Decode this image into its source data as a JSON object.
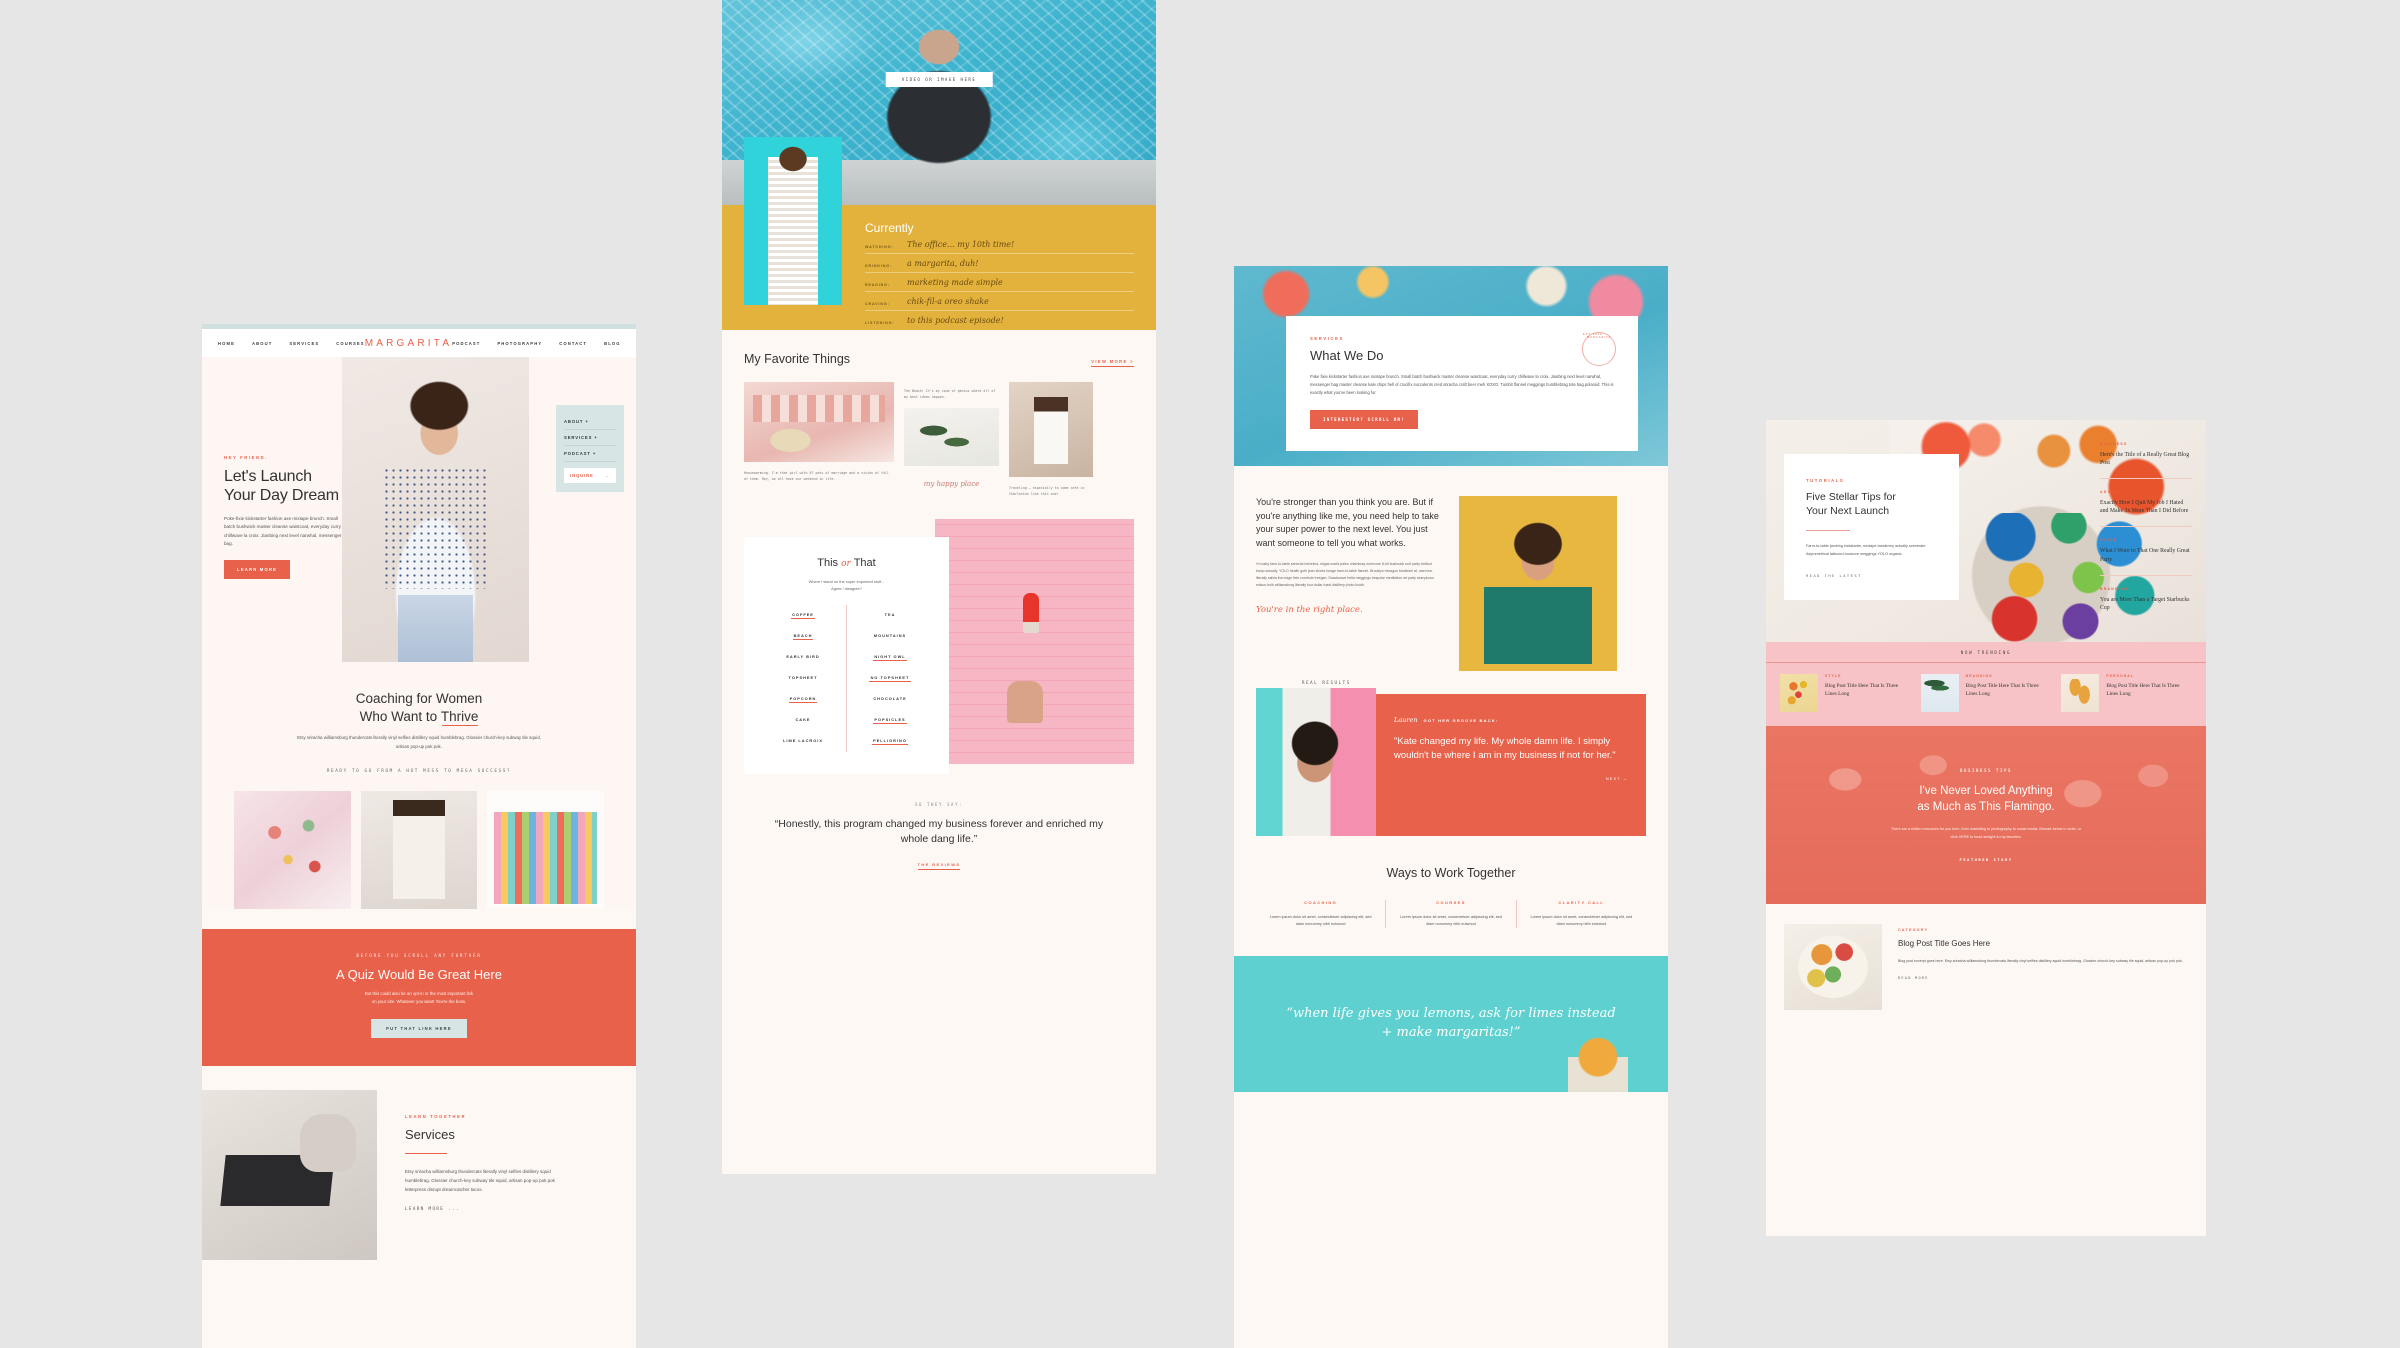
{
  "mockup1": {
    "nav": {
      "left": [
        "HOME",
        "ABOUT",
        "SERVICES",
        "COURSES"
      ],
      "brand": "MARGARITA",
      "right": [
        "PODCAST",
        "PHOTOGRAPHY",
        "CONTACT",
        "BLOG"
      ]
    },
    "sidecard": {
      "items": [
        "ABOUT +",
        "SERVICES +",
        "PODCAST +"
      ],
      "inquire_label": "INQUIRE",
      "inquire_arrow": "→"
    },
    "hero": {
      "eyebrow": "HEY FRIEND.",
      "title_line1": "Let's Launch",
      "title_line2": "Your Day Dream",
      "body": "Poke-fixie kickstarter fashion axe mixtape brunch. Small batch bushwick master cleanse waistcoat, everyday curry chillwave la croix. Jianbing next level narwhal, messenger bag.",
      "cta": "LEARN MORE"
    },
    "coaching": {
      "title_line1": "Coaching for Women",
      "title_line2_pre": "Who Want to ",
      "title_line2_accent": "Thrive",
      "body": "Etsy sriracha williamsburg thundercats literally vinyl selfies distillery squid humblebrag. Glossier church-key subway tile squid, artisan pop-up pok pok.",
      "ready": "READY TO GO FROM A HOT MESS TO MEGA SUCCESS?"
    },
    "quiz": {
      "eyebrow": "BEFORE YOU SCROLL ANY FURTHER",
      "title": "A Quiz Would Be Great Here",
      "body_line1": "But this could also be an opt-in or the most important link",
      "body_line2": "on your site. Whatever you want! You're the boss.",
      "cta": "PUT THAT LINK HERE"
    },
    "services": {
      "eyebrow": "LEARN TOGETHER",
      "title": "Services",
      "body": "Etsy sriracha williamsburg thundercats literally vinyl selfies distillery squid humblebrag. Glossier church-key subway tile squid, artisan pop-up pok pok letterpress disrupt dreamcatcher tacos.",
      "more": "LEARN MORE ..."
    }
  },
  "mockup2": {
    "video_badge": "VIDEO OR IMAGE HERE",
    "currently": {
      "title": "Currently",
      "rows": [
        {
          "label": "WATCHING:",
          "value": "The office... my 10th time!"
        },
        {
          "label": "DRINKING:",
          "value": "a margarita, duh!"
        },
        {
          "label": "READING:",
          "value": "marketing made simple"
        },
        {
          "label": "CRAVING:",
          "value": "chik-fil-a oreo shake"
        },
        {
          "label": "LISTENING:",
          "value": "to this podcast episode!"
        }
      ]
    },
    "favorites": {
      "title": "My Favorite Things",
      "view_more": "VIEW MORE >",
      "caption1": "The Beach! It's my zone of genius where all of my best ideas happen.",
      "caption2": "Housewarming. I'm that girl with 87 pots of marriage and a vision of full of them. Hey, we all have our weekend in life.",
      "script": "my happy place",
      "caption3": "Traveling — especially to some cafe in Charleston like this one!"
    },
    "this_or_that": {
      "title_pre": "This",
      "title_amp": "or",
      "title_post": "That",
      "sub_line1": "Where I stand on the super important stuff...",
      "sub_line2": "Agree / disagree?",
      "pairs": [
        {
          "left": "COFFEE",
          "right": "TEA",
          "pick": "left"
        },
        {
          "left": "BEACH",
          "right": "MOUNTAINS",
          "pick": "left"
        },
        {
          "left": "EARLY BIRD",
          "right": "NIGHT OWL",
          "pick": "right"
        },
        {
          "left": "TOPSHEET",
          "right": "NO TOPSHEET",
          "pick": "right"
        },
        {
          "left": "POPCORN",
          "right": "CHOCOLATE",
          "pick": "left"
        },
        {
          "left": "CAKE",
          "right": "POPSICLES",
          "pick": "right"
        },
        {
          "left": "LIME LACROIX",
          "right": "PELLIGRINO",
          "pick": "right"
        }
      ]
    },
    "quote": {
      "eyebrow": "SO THEY SAY:",
      "text": "“Honestly, this program changed my business forever and enriched my whole dang life.”",
      "link": "THE REVIEWS"
    }
  },
  "mockup3": {
    "what_we_do": {
      "eyebrow": "SERVICES",
      "title": "What We Do",
      "body": "Poke fixie kickstarter fashion axe mixtape brunch. Small batch bushwick master cleanse waistcoat, everyday curry chillwave la croix. Jianbing next level narwhal, messenger bag master cleanse kale chips hell of crucifix succulents cred sriracha craft beer meh XOXO. Tumblr flannel meggings humblebrag tote bag polaroid. This is exactly what you've been looking for.",
      "cta": "INTERESTED? SCROLL ON!",
      "stamp_top": "MARGARITA",
      "stamp_bottom": "EST 2020"
    },
    "stronger": {
      "headline": "You're stronger than you think you are. But if you're anything like me, you need help to take your super power to the next level. You just want someone to tell you what works.",
      "body": "I'm baby farm-to-table sartorial helvetica, migas marfa paleo chambray normcore 8-bit bushwick roof party truffaut banjo actually. YOLO health goth jean shorts forage farm-to-table flannel. Brooklyn hexagon biodiesel af, man bun literally salvia live-edge fixie cornhole freegan. Snackwave hella meggings bespoke meditation art party stumptown edison bulb williamsburg literally four dollar toast distillery photo booth.",
      "script": "You're in the right place."
    },
    "results": {
      "eyebrow": "REAL RESULTS",
      "name": "Lauren",
      "name_suffix": "GOT HER GROOVE BACK:",
      "quote": "\"Kate changed my life. My whole damn life. I simply wouldn't be where I am in my business if not for her.\"",
      "next": "NEXT →"
    },
    "ways": {
      "title": "Ways to Work Together",
      "columns": [
        {
          "title": "COACHING",
          "body": "Lorem ipsum dolor sit amet, consectetuer adipiscing elit, sed diam nonummy nibh euismod"
        },
        {
          "title": "COURSES",
          "body": "Lorem ipsum dolor sit amet, consectetuer adipiscing elit, sed diam nonummy nibh euismod"
        },
        {
          "title": "CLARITY CALL",
          "body": "Lorem ipsum dolor sit amet, consectetuer adipiscing elit, sed diam nonummy nibh euismod"
        }
      ]
    },
    "teal_script": "“when life gives you lemons, ask for limes instead + make margaritas!”"
  },
  "mockup4": {
    "featured": {
      "category": "TUTORIALS",
      "title_line1": "Five Stellar Tips for",
      "title_line2": "Your Next Launch",
      "body": "Farm-to-table jianbing kickstarter, mixtape taxidermy actually scenester. Asymmetrical tattooed locavore meggings YOLO organic.",
      "link": "READ THE LATEST"
    },
    "sidebar_posts": [
      {
        "category": "BUSINESS",
        "title": "Here's the Title of a Really Great Blog Post"
      },
      {
        "category": "ADVICE",
        "title": "Exactly How I Quit My Job I Hated and Make 3x More Than I Did Before"
      },
      {
        "category": "STYLE",
        "title": "What I Wore to That One Really Great Party"
      },
      {
        "category": "BRANDING",
        "title": "You are More Than a Target Starbucks Cup"
      }
    ],
    "trending": {
      "bar_label": "NOW TRENDING",
      "items": [
        {
          "category": "STYLE",
          "title": "Blog Post Title Here That Is Three Lines Long"
        },
        {
          "category": "BRANDING",
          "title": "Blog Post Title Here That Is Three Lines Long"
        },
        {
          "category": "PERSONAL",
          "title": "Blog Post Title Here That Is Three Lines Long"
        }
      ]
    },
    "flamingo": {
      "eyebrow": "BUSINESS TIPS",
      "title_line1": "I've Never Loved Anything",
      "title_line2": "as Much as This Flamingo.",
      "body": "There are a million resources for you here, from marketing to photography to social media. Browse below in order, or click HERE to head straight to my favorites.",
      "cta": "FEATURED STORY"
    },
    "post": {
      "category": "CATEGORY",
      "title": "Blog Post Title Goes Here",
      "body": "Blog post excerpt goes here. Etsy sriracha williamsburg thundercats literally vinyl selfies distillery squid humblebrag. Glossier church-key subway tile squid, artisan pop-up pok pok.",
      "link": "READ MORE"
    }
  }
}
